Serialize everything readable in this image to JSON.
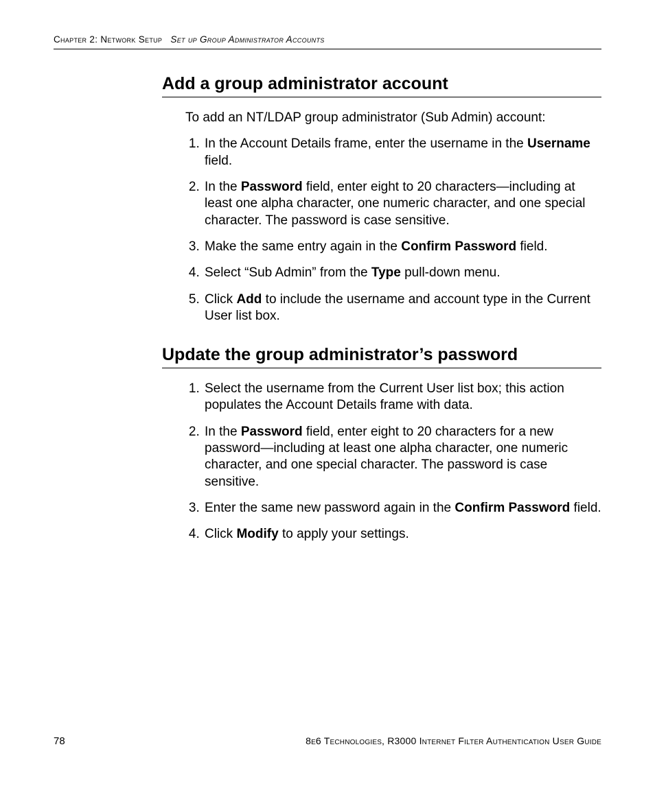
{
  "header": {
    "chapter": "Chapter 2: Network Setup",
    "section": "Set up Group Administrator Accounts"
  },
  "sectionA": {
    "title": "Add a group administrator account",
    "intro": "To add an NT/LDAP group administrator (Sub Admin) account:",
    "steps": {
      "s1a": "In the Account Details frame, enter the username in the ",
      "s1b": "Username",
      "s1c": " field.",
      "s2a": "In the ",
      "s2b": "Password",
      "s2c": " field, enter eight to 20 characters—including at least one alpha character, one numeric character, and one special character. The password is case sensitive.",
      "s3a": "Make the same entry again in the ",
      "s3b": "Confirm Password",
      "s3c": " field.",
      "s4a": "Select “Sub Admin” from the ",
      "s4b": "Type",
      "s4c": " pull-down menu.",
      "s5a": "Click ",
      "s5b": "Add",
      "s5c": " to include the username and account type in the Current User list box."
    }
  },
  "sectionB": {
    "title": "Update the group administrator’s password",
    "steps": {
      "s1": "Select the username from the Current User list box; this action populates the Account Details frame with data.",
      "s2a": "In the ",
      "s2b": "Password",
      "s2c": " field, enter eight to 20 characters for a new password—including at least one alpha character, one numeric character, and one special character. The password is case sensitive.",
      "s3a": "Enter the same new password again in the ",
      "s3b": "Confirm Password",
      "s3c": " field.",
      "s4a": "Click ",
      "s4b": "Modify",
      "s4c": " to apply your settings."
    }
  },
  "footer": {
    "page": "78",
    "doc": "8e6 Technologies, R3000 Internet Filter Authentication User Guide"
  }
}
